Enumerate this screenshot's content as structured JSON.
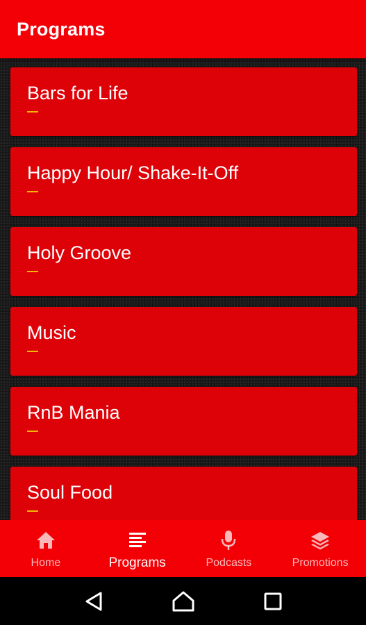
{
  "app_bar": {
    "title": "Programs"
  },
  "programs": [
    {
      "title": "Bars for Life"
    },
    {
      "title": "Happy Hour/ Shake-It-Off"
    },
    {
      "title": "Holy Groove"
    },
    {
      "title": "Music"
    },
    {
      "title": "RnB Mania"
    },
    {
      "title": "Soul Food"
    }
  ],
  "bottom_nav": {
    "items": [
      {
        "label": "Home",
        "icon": "home-icon",
        "active": false
      },
      {
        "label": "Programs",
        "icon": "list-icon",
        "active": true
      },
      {
        "label": "Podcasts",
        "icon": "microphone-icon",
        "active": false
      },
      {
        "label": "Promotions",
        "icon": "layers-icon",
        "active": false
      }
    ]
  },
  "system_nav": {
    "icons": [
      "back-icon",
      "home-icon",
      "recents-icon"
    ]
  },
  "colors": {
    "primary": "#f20006",
    "card": "#dd0208",
    "accent_dash": "#f5b800",
    "background": "#1a1a1a"
  }
}
